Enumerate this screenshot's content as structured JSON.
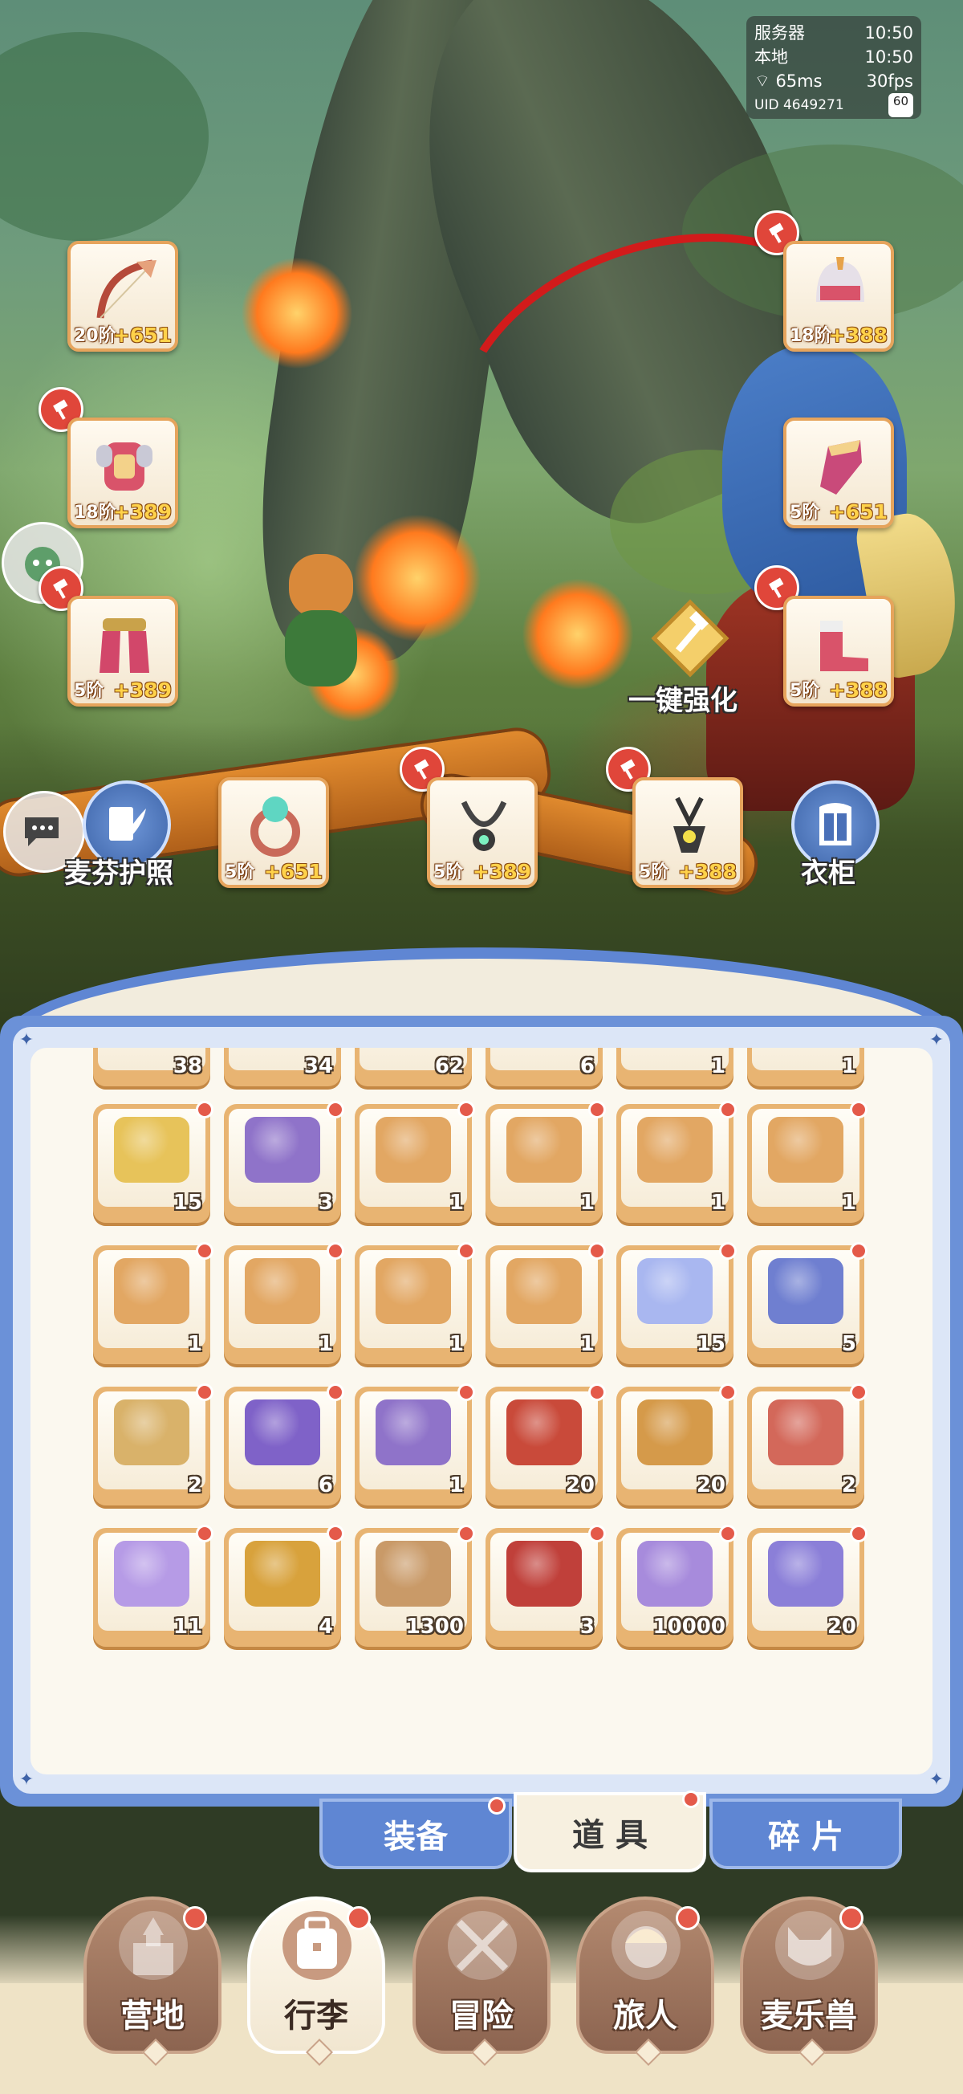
{
  "status": {
    "server_label": "服务器",
    "server_time": "10:50",
    "local_label": "本地",
    "local_time": "10:50",
    "ping": "65ms",
    "fps": "30fps",
    "uid": "UID 4649271",
    "fps_cap": "60"
  },
  "equipment": {
    "bow": {
      "level": "20阶",
      "bonus": "+651"
    },
    "armor": {
      "level": "18阶",
      "bonus": "+389"
    },
    "pants": {
      "level": "5阶",
      "bonus": "+389"
    },
    "helmet": {
      "level": "18阶",
      "bonus": "+388"
    },
    "gloves": {
      "level": "5阶",
      "bonus": "+651"
    },
    "boots": {
      "level": "5阶",
      "bonus": "+388"
    },
    "ring": {
      "level": "5阶",
      "bonus": "+651"
    },
    "necklace": {
      "level": "5阶",
      "bonus": "+389"
    },
    "amulet": {
      "level": "5阶",
      "bonus": "+388"
    }
  },
  "actions": {
    "auto_enhance": "一键强化",
    "passport": "麦芬护照",
    "wardrobe": "衣柜"
  },
  "inventory": {
    "row0": [
      "38",
      "34",
      "62",
      "6",
      "1",
      "1"
    ],
    "rows": [
      [
        {
          "qty": "15",
          "icon": "golden-bell-icon",
          "color": "#e7c35a"
        },
        {
          "qty": "3",
          "icon": "purple-chest-icon",
          "color": "#8f73c9"
        },
        {
          "qty": "1",
          "icon": "music-box-icon",
          "color": "#e2a763"
        },
        {
          "qty": "1",
          "icon": "music-box-icon",
          "color": "#e2a763"
        },
        {
          "qty": "1",
          "icon": "music-box-icon",
          "color": "#e2a763"
        },
        {
          "qty": "1",
          "icon": "music-box-icon",
          "color": "#e2a763"
        }
      ],
      [
        {
          "qty": "1",
          "icon": "music-box-icon",
          "color": "#e2a763"
        },
        {
          "qty": "1",
          "icon": "music-box-icon",
          "color": "#e2a763"
        },
        {
          "qty": "1",
          "icon": "music-box-icon",
          "color": "#e2a763"
        },
        {
          "qty": "1",
          "icon": "music-box-icon",
          "color": "#e2a763"
        },
        {
          "qty": "15",
          "icon": "character-card-icon",
          "color": "#a9b7f0"
        },
        {
          "qty": "5",
          "icon": "blue-card-icon",
          "color": "#6f7fd0"
        }
      ],
      [
        {
          "qty": "2",
          "icon": "gold-chest-icon",
          "color": "#d9b26a"
        },
        {
          "qty": "6",
          "icon": "purple-chest-icon",
          "color": "#7f62c8"
        },
        {
          "qty": "1",
          "icon": "purple-chest-icon",
          "color": "#8f73c9"
        },
        {
          "qty": "20",
          "icon": "red-chest-icon",
          "color": "#c94a3a"
        },
        {
          "qty": "20",
          "icon": "treasure-chest-icon",
          "color": "#d59a4a"
        },
        {
          "qty": "2",
          "icon": "red-chest-icon",
          "color": "#d3685a"
        }
      ],
      [
        {
          "qty": "11",
          "icon": "letter-card-icon",
          "color": "#b69be6"
        },
        {
          "qty": "4",
          "icon": "workbench-icon",
          "color": "#d8a23c"
        },
        {
          "qty": "1300",
          "icon": "bread-oven-icon",
          "color": "#c99a68"
        },
        {
          "qty": "3",
          "icon": "red-chest-icon",
          "color": "#c0403a"
        },
        {
          "qty": "10000",
          "icon": "crystal-chest-icon",
          "color": "#a78bdc"
        },
        {
          "qty": "20",
          "icon": "gem-pile-icon",
          "color": "#8b7fd8"
        }
      ]
    ]
  },
  "tabs": {
    "equipment": "装备",
    "items": "道 具",
    "fragments": "碎 片"
  },
  "nav": {
    "camp": "营地",
    "luggage": "行李",
    "adventure": "冒险",
    "traveler": "旅人",
    "pets": "麦乐兽"
  }
}
